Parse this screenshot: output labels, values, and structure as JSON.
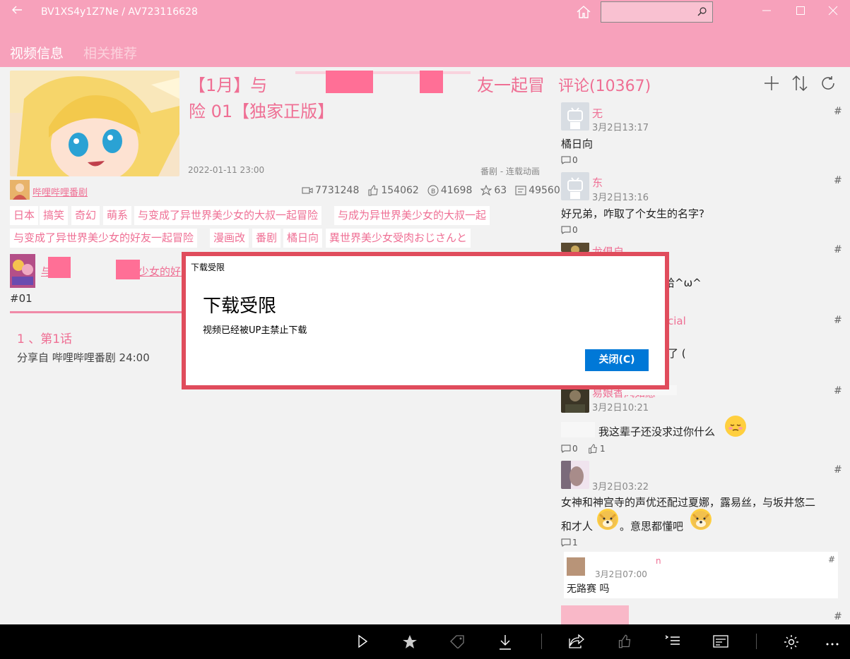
{
  "window": {
    "title": "BV1XS4y1Z7Ne / AV723116628",
    "search_placeholder": ""
  },
  "tabs": [
    {
      "label": "视频信息",
      "active": true
    },
    {
      "label": "相关推荐",
      "active": false
    }
  ],
  "video": {
    "title_line1_start": "【1月】与",
    "title_line1_end": "友一起冒",
    "title_line2": "险 01【独家正版】",
    "date": "2022-01-11 23:00",
    "category": "番剧 - 连载动画",
    "uploader": "哔哩哔哩番剧",
    "stats": {
      "views": "7731248",
      "likes": "154062",
      "coins": "41698",
      "favorites": "63",
      "danmaku": "49560"
    },
    "tags": [
      "日本",
      "搞笑",
      "奇幻",
      "萌系",
      "与变成了异世界美少女的大叔一起冒险",
      "与成为异世界美少女的大叔一起",
      "与变成了异世界美少女的好友一起冒险",
      "漫画改",
      "番剧",
      "橘日向",
      "異世界美少女受肉おじさんと"
    ],
    "season_title_start": "与",
    "season_title_end": "少女的好友",
    "episode_number": "#01",
    "episode_title": "1 、第1话",
    "episode_sub": "分享自 哔哩哔哩番剧 24:00"
  },
  "comments": {
    "header": "评论(10367)",
    "items": [
      {
        "name": "无",
        "time": "3月2日13:17",
        "text": "橘日向",
        "replies": "0",
        "likes": ""
      },
      {
        "name": "东",
        "time": "3月2日13:16",
        "text": "好兄弟，咋取了个女生的名字?",
        "replies": "0",
        "likes": ""
      },
      {
        "name": "龙俱自",
        "time": "",
        "text": "哈^ω^",
        "replies": "",
        "likes": ""
      },
      {
        "name": "cial",
        "time": "",
        "text": "了 (",
        "replies": "",
        "likes": ""
      },
      {
        "name": "易娘香风如愿",
        "time": "3月2日10:21",
        "text": "我这辈子还没求过你什么",
        "replies": "0",
        "likes": "1"
      },
      {
        "name": "",
        "time": "3月2日03:22",
        "text": "女神和神宫寺的声优还配过夏娜，露易丝，与坂井悠二",
        "text2_a": "和才人",
        "text2_b": "。意思都懂吧",
        "replies": "1",
        "likes": ""
      },
      {
        "name": "n",
        "time": "3月2日07:00",
        "text": "无路赛 吗",
        "replies": "",
        "likes": ""
      }
    ],
    "hash": "#"
  },
  "dialog": {
    "caption": "下载受限",
    "title": "下载受限",
    "message": "视频已经被UP主禁止下载",
    "button": "关闭(C)"
  },
  "colors": {
    "accent": "#f7a1bb",
    "pink_text": "#ef6f94",
    "dialog_border": "#e04c5c",
    "button_blue": "#0078d7"
  }
}
